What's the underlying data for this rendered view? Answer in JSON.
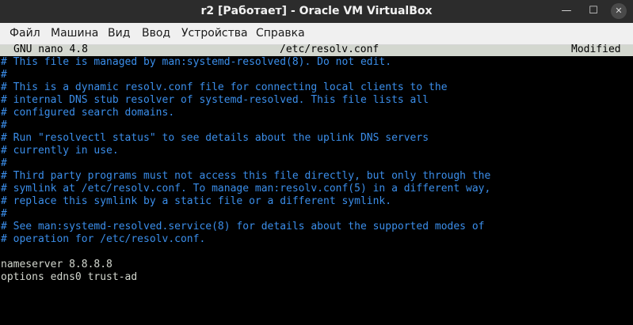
{
  "window": {
    "title": "r2 [Работает] - Oracle VM VirtualBox",
    "minimize_icon": "—",
    "maximize_icon": "☐",
    "close_icon": "✕"
  },
  "menu": {
    "items": [
      "Файл",
      "Машина",
      "Вид",
      "Ввод",
      "Устройства",
      "Справка"
    ]
  },
  "nano": {
    "version": "GNU nano 4.8",
    "filename": "/etc/resolv.conf",
    "status": "Modified"
  },
  "file": {
    "lines": [
      {
        "text": "# This file is managed by man:systemd-resolved(8). Do not edit.",
        "kind": "comment"
      },
      {
        "text": "#",
        "kind": "comment"
      },
      {
        "text": "# This is a dynamic resolv.conf file for connecting local clients to the",
        "kind": "comment"
      },
      {
        "text": "# internal DNS stub resolver of systemd-resolved. This file lists all",
        "kind": "comment"
      },
      {
        "text": "# configured search domains.",
        "kind": "comment"
      },
      {
        "text": "#",
        "kind": "comment"
      },
      {
        "text": "# Run \"resolvectl status\" to see details about the uplink DNS servers",
        "kind": "comment"
      },
      {
        "text": "# currently in use.",
        "kind": "comment"
      },
      {
        "text": "#",
        "kind": "comment"
      },
      {
        "text": "# Third party programs must not access this file directly, but only through the",
        "kind": "comment"
      },
      {
        "text": "# symlink at /etc/resolv.conf. To manage man:resolv.conf(5) in a different way,",
        "kind": "comment"
      },
      {
        "text": "# replace this symlink by a static file or a different symlink.",
        "kind": "comment"
      },
      {
        "text": "#",
        "kind": "comment"
      },
      {
        "text": "# See man:systemd-resolved.service(8) for details about the supported modes of",
        "kind": "comment"
      },
      {
        "text": "# operation for /etc/resolv.conf.",
        "kind": "comment"
      },
      {
        "text": "",
        "kind": "plain"
      },
      {
        "text": "nameserver 8.8.8.8",
        "kind": "plain"
      },
      {
        "text": "options edns0 trust-ad",
        "kind": "plain"
      }
    ]
  },
  "colors": {
    "comment": "#3b8eea",
    "text": "#d3d7cf",
    "header_bg": "#d3d7cf",
    "terminal_bg": "#000000",
    "titlebar_bg": "#2c2c2c",
    "menubar_bg": "#f0f0f0"
  }
}
